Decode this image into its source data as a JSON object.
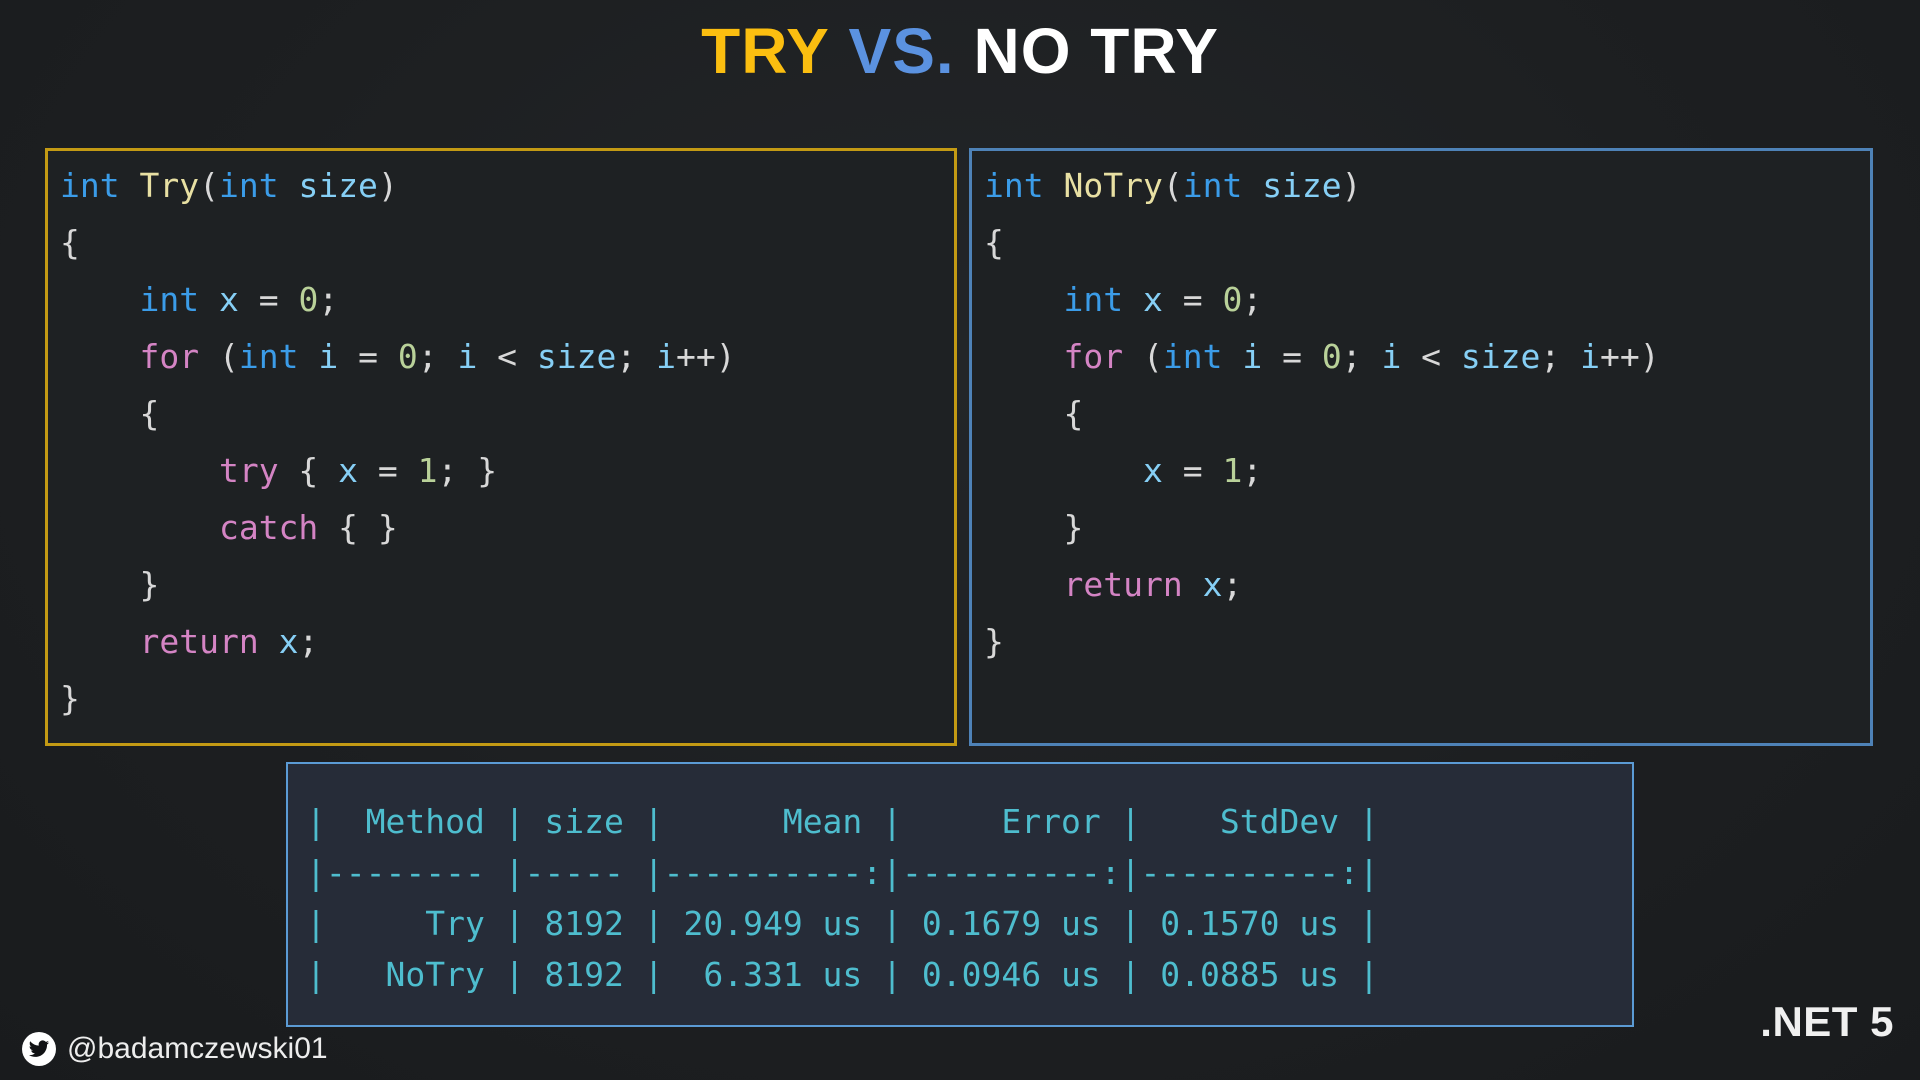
{
  "title": {
    "part1": "TRY",
    "part2": "VS.",
    "part3": "NO TRY",
    "colors": {
      "part1": "#FBBE10",
      "part2": "#5B92E0",
      "part3": "#FFFFFF"
    }
  },
  "panels": {
    "try": {
      "name": "Try",
      "border_color": "#C39A14",
      "code": "int Try(int size)\n{\n    int x = 0;\n    for (int i = 0; i < size; i++)\n    {\n        try { x = 1; }\n        catch { }\n    }\n    return x;\n}",
      "lines": [
        "int Try(int size)",
        "{",
        "    int x = 0;",
        "    for (int i = 0; i < size; i++)",
        "    {",
        "        try { x = 1; }",
        "        catch { }",
        "    }",
        "    return x;",
        "}"
      ]
    },
    "notry": {
      "name": "NoTry",
      "border_color": "#4E82B7",
      "code": "int NoTry(int size)\n{\n    int x = 0;\n    for (int i = 0; i < size; i++)\n    {\n        x = 1;\n    }\n    return x;\n}",
      "lines": [
        "int NoTry(int size)",
        "{",
        "    int x = 0;",
        "    for (int i = 0; i < size; i++)",
        "    {",
        "        x = 1;",
        "    }",
        "    return x;",
        "}"
      ]
    }
  },
  "benchmark": {
    "border_color": "#5B9BD5",
    "text_color": "#4EBDCE",
    "columns": [
      "Method",
      "size",
      "Mean",
      "Error",
      "StdDev"
    ],
    "rows": [
      {
        "Method": "Try",
        "size": "8192",
        "Mean": "20.949 us",
        "Error": "0.1679 us",
        "StdDev": "0.1570 us"
      },
      {
        "Method": "NoTry",
        "size": "8192",
        "Mean": "6.331 us",
        "Error": "0.0946 us",
        "StdDev": "0.0885 us"
      }
    ],
    "raw": "|  Method | size |      Mean |     Error |    StdDev |\n|-------- |----- |----------:|----------:|----------:|\n|     Try | 8192 | 20.949 us | 0.1679 us | 0.1570 us |\n|   NoTry | 8192 |  6.331 us | 0.0946 us | 0.0885 us |",
    "header_line": "|  Method | size |      Mean |     Error |    StdDev |",
    "separator_line": "|-------- |----- |----------:|----------:|----------:|",
    "row_lines": [
      "|     Try | 8192 | 20.949 us | 0.1679 us | 0.1570 us |",
      "|   NoTry | 8192 |  6.331 us | 0.0946 us | 0.0885 us |"
    ]
  },
  "footer": {
    "twitter_icon": "twitter-bird-icon",
    "handle": "@badamczewski01",
    "framework": ".NET 5"
  },
  "theme": {
    "background": "#1e2022",
    "code_background": "#1e2123",
    "keyword": "#3B9CE8",
    "control": "#D484C4",
    "method": "#E8E0A3",
    "identifier": "#86CFF5",
    "number": "#B9D199",
    "punctuation": "#D8D8D8"
  }
}
